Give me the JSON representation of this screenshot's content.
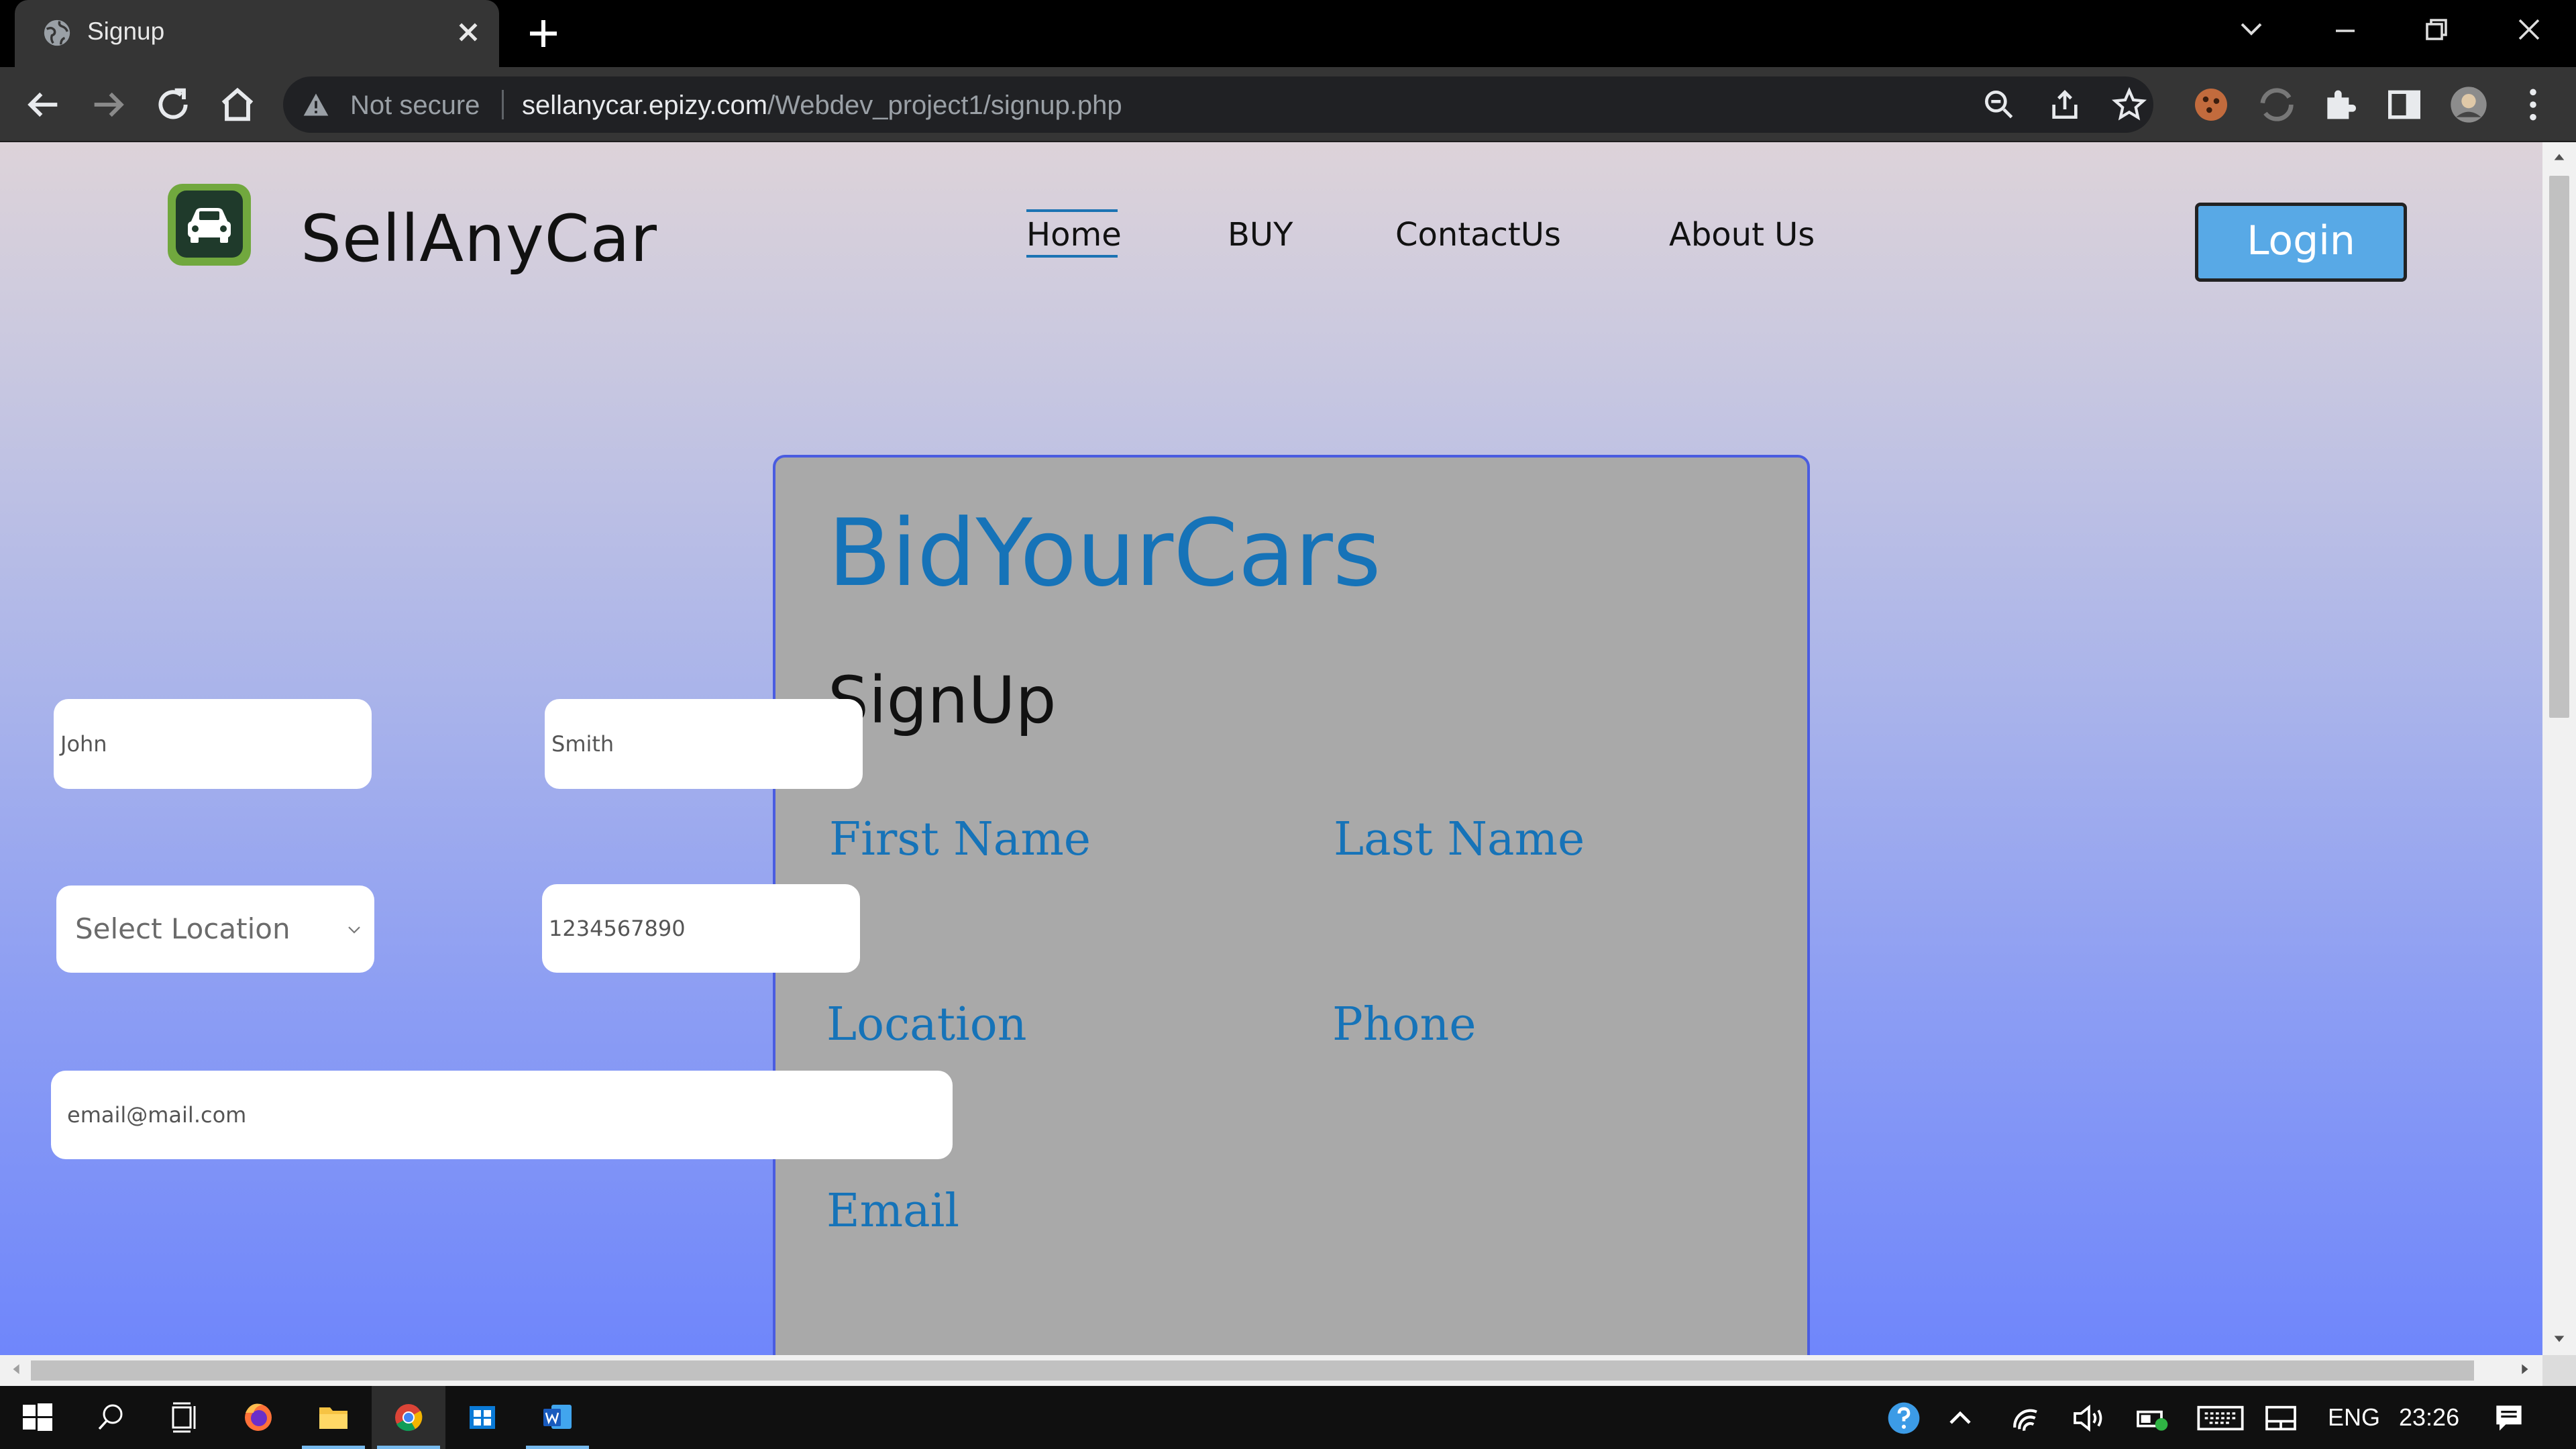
{
  "browser": {
    "tab_title": "Signup",
    "security_label": "Not secure",
    "url_host": "sellanycar.epizy.com",
    "url_path": "/Webdev_project1/signup.php"
  },
  "site": {
    "brand": "SellAnyCar",
    "nav": [
      "Home",
      "BUY",
      "ContactUs",
      "About Us"
    ],
    "active_nav": "Home",
    "login_label": "Login"
  },
  "form": {
    "title": "BidYourCars",
    "subtitle": "SignUp",
    "first_name_label": "First Name",
    "first_name_placeholder": "John",
    "last_name_label": "Last Name",
    "last_name_placeholder": "Smith",
    "location_label": "Location",
    "location_selected": "Select Location",
    "phone_label": "Phone",
    "phone_placeholder": "1234567890",
    "email_label": "Email",
    "email_placeholder": "email@mail.com"
  },
  "taskbar": {
    "language": "ENG",
    "clock": "23:26"
  },
  "colors": {
    "accent_blue": "#1673b8",
    "card_bg": "#a9a9a9",
    "login_bg": "#58a9e6"
  },
  "icons": [
    "globe-icon",
    "close-icon",
    "plus-icon",
    "back-icon",
    "forward-icon",
    "reload-icon",
    "home-icon",
    "warning-icon",
    "zoom-icon",
    "share-icon",
    "star-icon",
    "puzzle-icon",
    "profile-icon",
    "kebab-menu-icon",
    "car-icon",
    "windows-start-icon",
    "search-icon"
  ]
}
